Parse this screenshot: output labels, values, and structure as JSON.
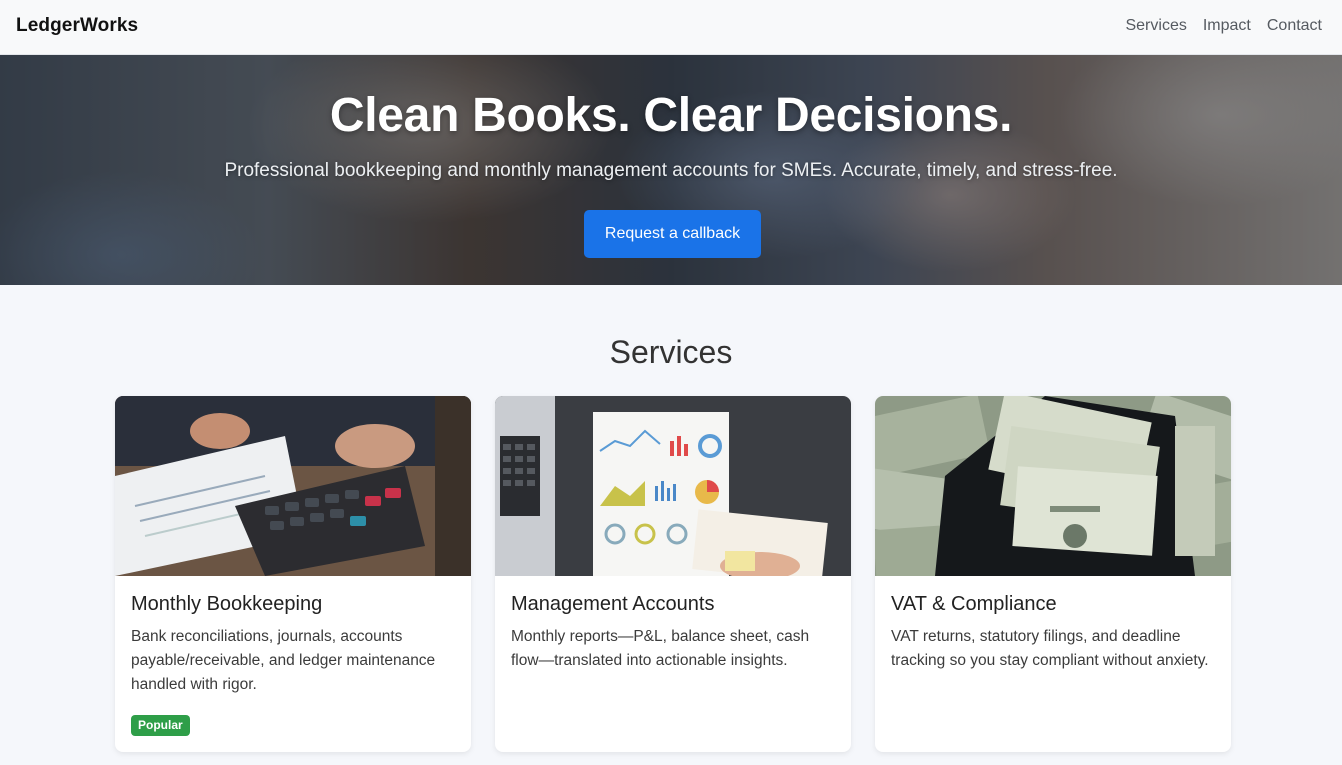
{
  "navbar": {
    "brand": "LedgerWorks",
    "links": [
      "Services",
      "Impact",
      "Contact"
    ]
  },
  "hero": {
    "title": "Clean Books. Clear Decisions.",
    "subtitle": "Professional bookkeeping and monthly management accounts for SMEs. Accurate, timely, and stress-free.",
    "cta_label": "Request a callback"
  },
  "services": {
    "title": "Services",
    "cards": [
      {
        "title": "Monthly Bookkeeping",
        "text": "Bank reconciliations, journals, accounts payable/receivable, and ledger maintenance handled with rigor.",
        "badge": "Popular",
        "image": "calculator-photo"
      },
      {
        "title": "Management Accounts",
        "text": "Monthly reports—P&L, balance sheet, cash flow—translated into actionable insights.",
        "image": "charts-report-photo"
      },
      {
        "title": "VAT & Compliance",
        "text": "VAT returns, statutory filings, and deadline tracking so you stay compliant without anxiety.",
        "image": "cash-envelope-photo"
      }
    ]
  },
  "colors": {
    "primary": "#1a73e8",
    "badge": "#2e9e48",
    "page_bg": "#f5f7fb"
  }
}
